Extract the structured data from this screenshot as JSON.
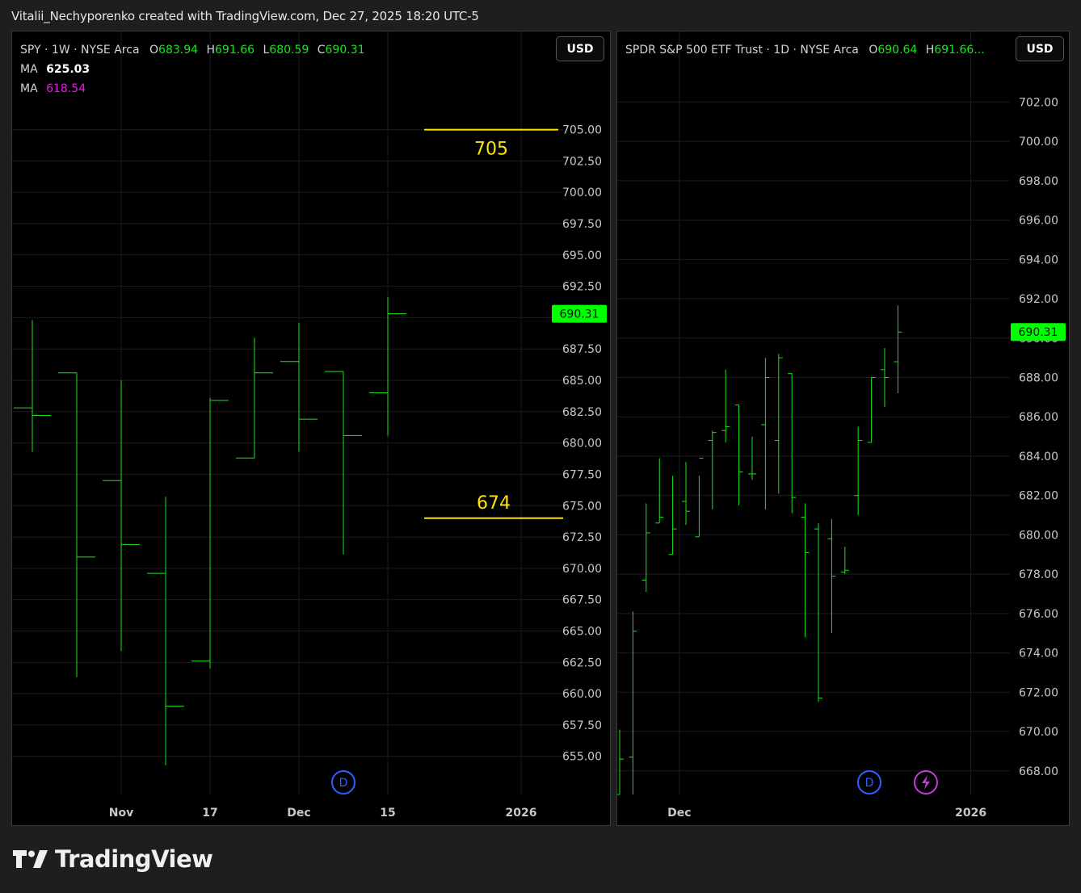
{
  "header": {
    "caption": "Vitalii_Nechyporenko created with TradingView.com, Dec 27, 2025 18:20 UTC-5"
  },
  "brand": {
    "name": "TradingView"
  },
  "colors": {
    "bar": "#19e619",
    "price_tag": "#00ff00",
    "level_line": "#ffe600",
    "ma2": "#e619e6",
    "event_d": "#2962ff",
    "event_bolt": "#c33bd9"
  },
  "left": {
    "legend": {
      "symbol": "SPY · 1W · NYSE Arca",
      "o_label": "O",
      "o": "683.94",
      "h_label": "H",
      "h": "691.66",
      "l_label": "L",
      "l": "680.59",
      "c_label": "C",
      "c": "690.31",
      "ma1_label": "MA",
      "ma1": "625.03",
      "ma2_label": "MA",
      "ma2": "618.54"
    },
    "currency": "USD",
    "price_tag": "690.31",
    "event_d_label": "D"
  },
  "right": {
    "legend": {
      "symbol": "SPDR S&P 500 ETF Trust · 1D · NYSE Arca",
      "o_label": "O",
      "o": "690.64",
      "h_label": "H",
      "h": "691.66..."
    },
    "currency": "USD",
    "price_tag": "690.31",
    "event_d_label": "D",
    "event_bolt_icon": "lightning-bolt-icon"
  },
  "chart_data": [
    {
      "type": "ohlc",
      "title": "SPY · 1W · NYSE Arca",
      "ylim": [
        653.5,
        708
      ],
      "y_ticks": [
        "705.00",
        "702.50",
        "700.00",
        "697.50",
        "695.00",
        "692.50",
        "690.00",
        "687.50",
        "685.00",
        "682.50",
        "680.00",
        "677.50",
        "675.00",
        "672.50",
        "670.00",
        "667.50",
        "665.00",
        "662.50",
        "660.00",
        "657.50",
        "655.00"
      ],
      "x_ticks": [
        "Nov",
        "17",
        "Dec",
        "15",
        "2026"
      ],
      "x_tick_index": [
        2,
        4,
        6,
        8,
        11
      ],
      "bars": [
        {
          "o": 682.8,
          "h": 689.8,
          "l": 679.3,
          "c": 682.2
        },
        {
          "o": 685.6,
          "h": 685.6,
          "l": 661.3,
          "c": 670.9
        },
        {
          "o": 677.0,
          "h": 685.0,
          "l": 663.4,
          "c": 671.9
        },
        {
          "o": 669.6,
          "h": 675.7,
          "l": 654.3,
          "c": 659.0
        },
        {
          "o": 662.6,
          "h": 683.6,
          "l": 662.0,
          "c": 683.4
        },
        {
          "o": 678.8,
          "h": 688.4,
          "l": 678.8,
          "c": 685.6
        },
        {
          "o": 686.5,
          "h": 689.6,
          "l": 679.3,
          "c": 681.9
        },
        {
          "o": 685.7,
          "h": 685.7,
          "l": 671.1,
          "c": 680.6
        },
        {
          "o": 684.0,
          "h": 691.66,
          "l": 680.59,
          "c": 690.31
        }
      ],
      "levels": [
        {
          "value": 705,
          "label": "705"
        },
        {
          "value": 674,
          "label": "674"
        }
      ],
      "last_price": 690.31,
      "ma": [
        {
          "name": "MA",
          "value": 625.03
        },
        {
          "name": "MA",
          "value": 618.54
        }
      ]
    },
    {
      "type": "ohlc",
      "title": "SPDR S&P 500 ETF Trust · 1D · NYSE Arca",
      "ylim": [
        666.8,
        703.7
      ],
      "y_ticks": [
        "702.00",
        "700.00",
        "698.00",
        "696.00",
        "694.00",
        "692.00",
        "690.00",
        "688.00",
        "686.00",
        "684.00",
        "682.00",
        "680.00",
        "678.00",
        "676.00",
        "674.00",
        "672.00",
        "670.00",
        "668.00"
      ],
      "x_ticks": [
        "Dec",
        "2026"
      ],
      "x_tick_index": [
        4.5,
        26.5
      ],
      "bars": [
        {
          "o": 666.8,
          "h": 670.1,
          "l": 666.8,
          "c": 668.6
        },
        {
          "o": 668.7,
          "h": 676.1,
          "l": 666.8,
          "c": 675.1
        },
        {
          "o": 677.7,
          "h": 681.6,
          "l": 677.1,
          "c": 680.1
        },
        {
          "o": 680.6,
          "h": 683.9,
          "l": 680.6,
          "c": 680.9
        },
        {
          "o": 679.0,
          "h": 683.0,
          "l": 679.0,
          "c": 680.3
        },
        {
          "o": 681.7,
          "h": 683.7,
          "l": 680.5,
          "c": 681.2
        },
        {
          "o": 679.9,
          "h": 683.0,
          "l": 679.9,
          "c": 683.9
        },
        {
          "o": 684.8,
          "h": 685.3,
          "l": 681.3,
          "c": 685.2
        },
        {
          "o": 685.3,
          "h": 688.4,
          "l": 684.7,
          "c": 685.5
        },
        {
          "o": 686.6,
          "h": 686.6,
          "l": 681.5,
          "c": 683.2
        },
        {
          "o": 683.1,
          "h": 685.0,
          "l": 682.8,
          "c": 683.1
        },
        {
          "o": 685.6,
          "h": 689.0,
          "l": 681.3,
          "c": 688.0
        },
        {
          "o": 684.8,
          "h": 689.2,
          "l": 682.1,
          "c": 689.0
        },
        {
          "o": 688.2,
          "h": 688.2,
          "l": 681.1,
          "c": 681.9
        },
        {
          "o": 680.9,
          "h": 681.6,
          "l": 674.8,
          "c": 679.1
        },
        {
          "o": 680.3,
          "h": 680.6,
          "l": 671.5,
          "c": 671.7
        },
        {
          "o": 679.8,
          "h": 680.8,
          "l": 675.0,
          "c": 677.9
        },
        {
          "o": 678.1,
          "h": 679.4,
          "l": 678.0,
          "c": 678.2
        },
        {
          "o": 682.0,
          "h": 685.5,
          "l": 681.0,
          "c": 684.8
        },
        {
          "o": 684.7,
          "h": 688.0,
          "l": 684.7,
          "c": 688.0
        },
        {
          "o": 688.4,
          "h": 689.5,
          "l": 686.5,
          "c": 688.0
        },
        {
          "o": 688.8,
          "h": 691.66,
          "l": 687.2,
          "c": 690.31
        }
      ],
      "last_price": 690.31
    }
  ]
}
